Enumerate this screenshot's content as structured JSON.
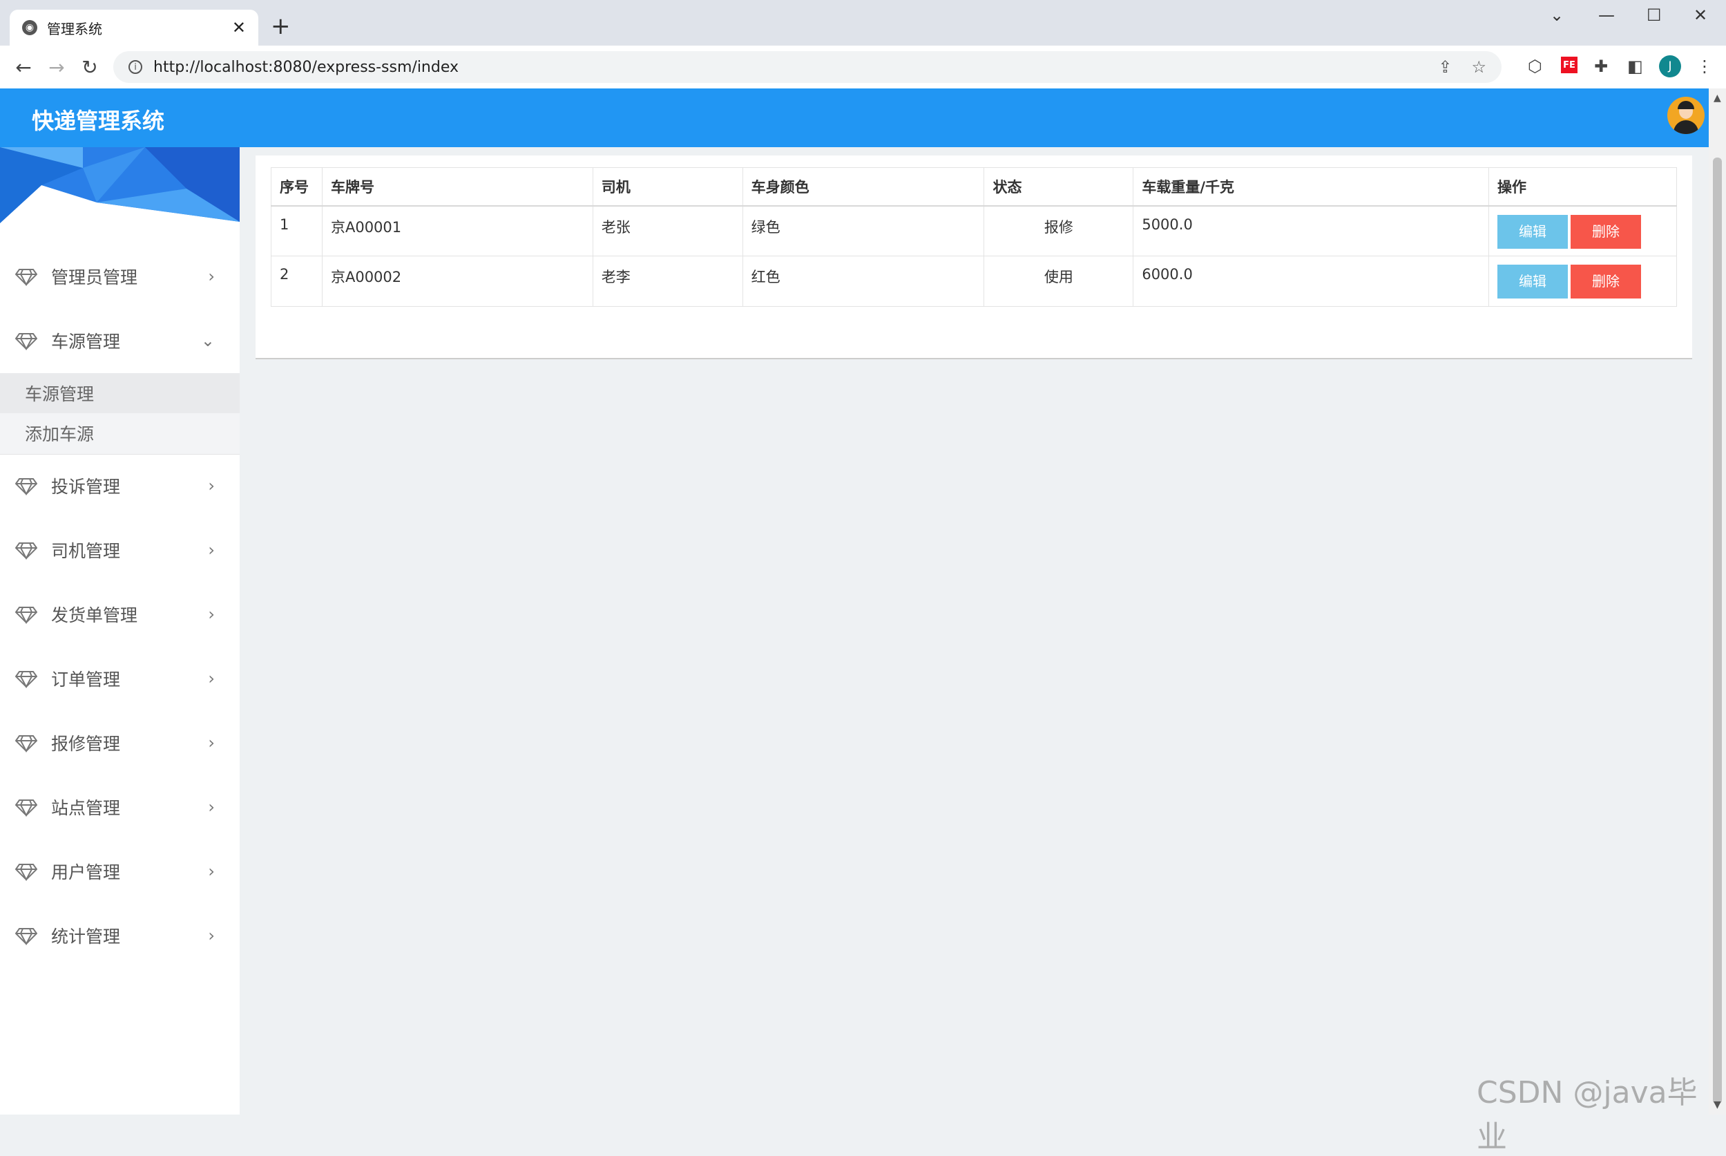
{
  "browser": {
    "tab_title": "管理系统",
    "tab_close": "✕",
    "new_tab": "+",
    "url": "http://localhost:8080/express-ssm/index",
    "profile_initial": "J",
    "ext_fe": "FE"
  },
  "header": {
    "title": "快递管理系统"
  },
  "sidebar": {
    "items": [
      {
        "label": "管理员管理",
        "chevron": "›"
      },
      {
        "label": "车源管理",
        "chevron": "⌄"
      },
      {
        "label": "投诉管理",
        "chevron": "›"
      },
      {
        "label": "司机管理",
        "chevron": "›"
      },
      {
        "label": "发货单管理",
        "chevron": "›"
      },
      {
        "label": "订单管理",
        "chevron": "›"
      },
      {
        "label": "报修管理",
        "chevron": "›"
      },
      {
        "label": "站点管理",
        "chevron": "›"
      },
      {
        "label": "用户管理",
        "chevron": "›"
      },
      {
        "label": "统计管理",
        "chevron": "›"
      }
    ],
    "submenu": [
      "车源管理",
      "添加车源"
    ]
  },
  "table": {
    "headers": [
      "序号",
      "车牌号",
      "司机",
      "车身颜色",
      "状态",
      "车载重量/千克",
      "操作"
    ],
    "rows": [
      {
        "no": "1",
        "plate": "京A00001",
        "driver": "老张",
        "color": "绿色",
        "status": "报修",
        "weight": "5000.0"
      },
      {
        "no": "2",
        "plate": "京A00002",
        "driver": "老李",
        "color": "红色",
        "status": "使用",
        "weight": "6000.0"
      }
    ],
    "edit_label": "编辑",
    "delete_label": "删除"
  },
  "watermark": "CSDN @java毕业",
  "colors": {
    "header": "#2196f3",
    "edit": "#6cc4ea",
    "delete": "#f7564a"
  }
}
